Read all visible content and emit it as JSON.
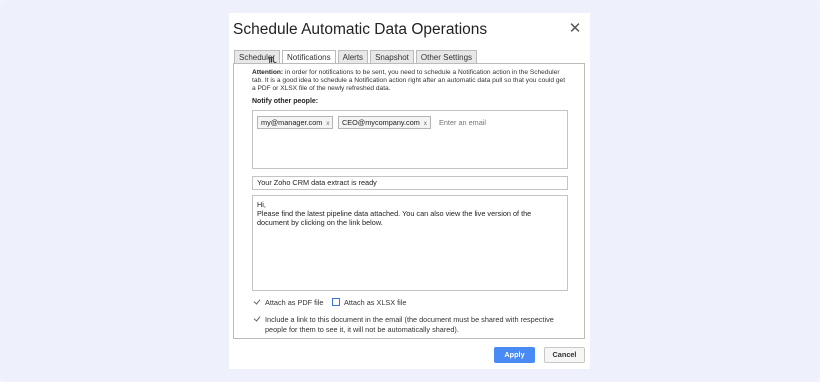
{
  "dialog": {
    "title": "Schedule Automatic Data Operations",
    "close_icon": "close-icon"
  },
  "tabs": [
    {
      "label": "Scheduler",
      "active": false
    },
    {
      "label": "Notifications",
      "active": true
    },
    {
      "label": "Alerts",
      "active": false
    },
    {
      "label": "Snapshot",
      "active": false
    },
    {
      "label": "Other Settings",
      "active": false
    }
  ],
  "notifications": {
    "attention_label": "Attention:",
    "attention_text": " in order for notifications to be sent, you need to schedule a Notification action in the Scheduler tab. It is a good idea to schedule a Notification action right after an automatic data pull so that you could get a PDF or XLSX file of the newly refreshed data.",
    "notify_label": "Notify other people:",
    "recipients": [
      "my@manager.com",
      "CEO@mycompany.com"
    ],
    "chip_remove": "x",
    "email_placeholder": "Enter an email",
    "subject": "Your Zoho CRM data extract is ready",
    "body_line1": "Hi,",
    "body_line2": "Please find the latest pipeline data attached. You can also view the live version of the document by clicking on the link below.",
    "attach_pdf": {
      "label": "Attach as PDF file",
      "checked": true
    },
    "attach_xlsx": {
      "label": "Attach as XLSX file",
      "checked": false
    },
    "include_link": {
      "label": "Include a link to this document in the email (the document must be shared with respective people for them to see it, it will not be automatically shared).",
      "checked": true
    }
  },
  "footer": {
    "apply_label": "Apply",
    "cancel_label": "Cancel"
  },
  "colors": {
    "apply_button": "#4a8af4",
    "background": "#eef0fb",
    "checkbox_outline": "#3d73d6"
  }
}
